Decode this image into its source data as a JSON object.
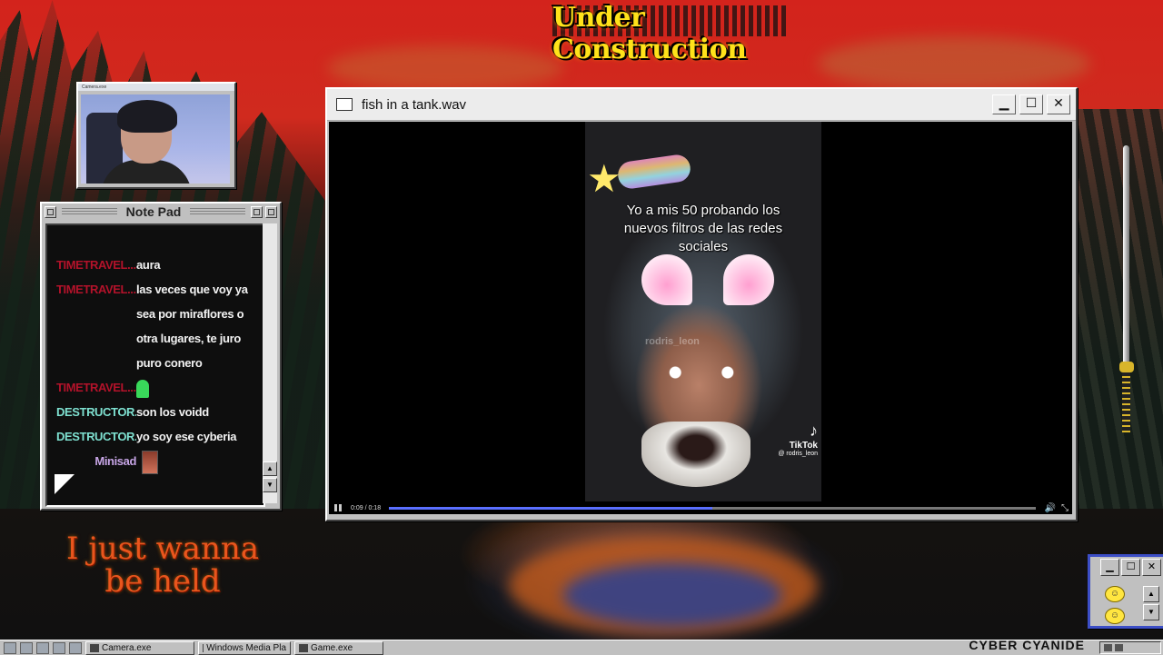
{
  "banner": {
    "title": "Under Construction"
  },
  "camera_window": {
    "title": "Camera.exe"
  },
  "notepad": {
    "title": "Note Pad",
    "messages": [
      {
        "user": "TIMETRAVEL...",
        "text": "aura",
        "color": "#b3122a"
      },
      {
        "user": "TIMETRAVEL...",
        "text": "las veces que voy ya sea por miraflores o otra lugares, te juro puro conero",
        "color": "#b3122a"
      },
      {
        "user": "TIMETRAVEL...",
        "text": "",
        "emote": "ghost-emote",
        "color": "#b3122a"
      },
      {
        "user": "DESTRUCTOR...",
        "text": "son los voidd",
        "color": "#7ee0d0"
      },
      {
        "user": "DESTRUCTOR...",
        "text": "yo soy ese cyberia",
        "color": "#7ee0d0"
      },
      {
        "user": "Minisad",
        "text": "",
        "emote": "picture-emote",
        "color": "#c7a5e6"
      }
    ]
  },
  "overlay_text": {
    "line1": "I just wanna",
    "line2": "be held"
  },
  "player": {
    "title": "fish in a tank.wav",
    "buttons": {
      "minimize": "▁",
      "maximize": "☐",
      "close": "✕"
    },
    "video": {
      "caption": "Yo a mis 50 probando los nuevos filtros de las redes sociales",
      "watermark": "rodris_leon",
      "platform": "TikTok",
      "handle": "@ rodris_leon"
    },
    "controls": {
      "time": "0:09 / 0:18",
      "progress": 0.5
    }
  },
  "taskbar": {
    "tasks": [
      "Camera.exe",
      "Windows Media Pla",
      "Game.exe"
    ],
    "brand": "CYBER CYANIDE"
  },
  "colors": {
    "accent_blue": "#3c4ec6",
    "progress": "#5a6fff",
    "banner_yellow": "#ffe21a"
  }
}
